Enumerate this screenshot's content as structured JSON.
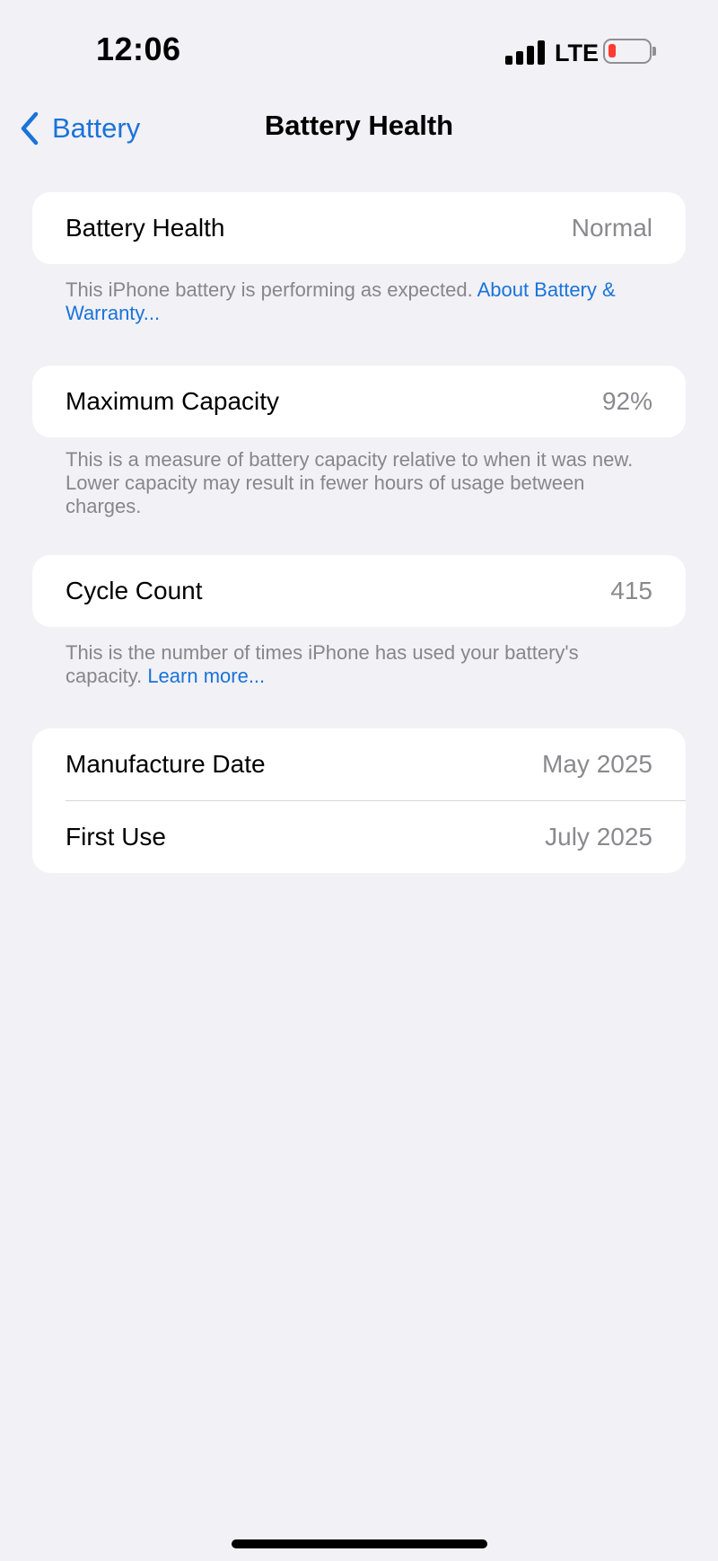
{
  "status_bar": {
    "time": "12:06",
    "network": "LTE",
    "battery_level_color": "#ff3b30",
    "signal_bars": 4
  },
  "nav": {
    "back_label": "Battery",
    "title": "Battery Health",
    "accent_color": "#1a73d9"
  },
  "health": {
    "label": "Battery Health",
    "value": "Normal",
    "footnote_text": "This iPhone battery is performing as expected. ",
    "footnote_link": "About Battery & Warranty..."
  },
  "capacity": {
    "label": "Maximum Capacity",
    "value": "92%",
    "footnote_text": "This is a measure of battery capacity relative to when it was new. Lower capacity may result in fewer hours of usage between charges."
  },
  "cycles": {
    "label": "Cycle Count",
    "value": "415",
    "footnote_text": "This is the number of times iPhone has used your battery's capacity. ",
    "footnote_link": "Learn more..."
  },
  "dates": {
    "manufacture_label": "Manufacture Date",
    "manufacture_value": "May 2025",
    "first_use_label": "First Use",
    "first_use_value": "July 2025"
  }
}
